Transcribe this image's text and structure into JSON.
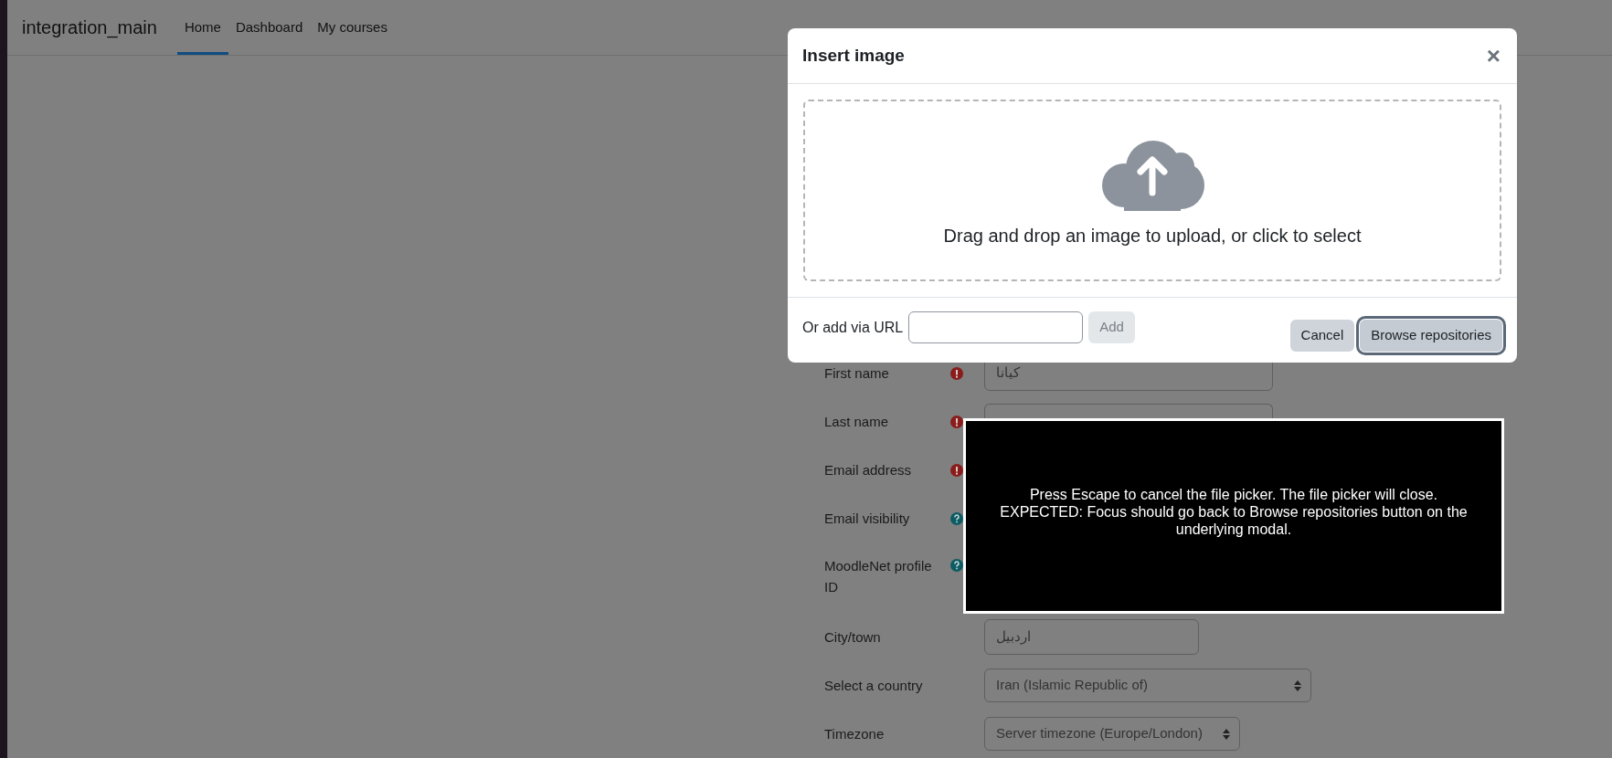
{
  "navbar": {
    "brand": "integration_main",
    "items": [
      {
        "label": "Home",
        "selected": true
      },
      {
        "label": "Dashboard",
        "selected": false
      },
      {
        "label": "My courses",
        "selected": false
      }
    ]
  },
  "form": {
    "fields": [
      {
        "label": "First name",
        "required": true,
        "help": false,
        "kind": "text",
        "value": "کیانا"
      },
      {
        "label": "Last name",
        "required": true,
        "help": false,
        "kind": "partial"
      },
      {
        "label": "Email address",
        "required": true,
        "help": false,
        "kind": "covered"
      },
      {
        "label": "Email visibility",
        "required": false,
        "help": true,
        "kind": "covered"
      },
      {
        "label": "MoodleNet profile ID",
        "required": false,
        "help": true,
        "kind": "covered"
      },
      {
        "label": "City/town",
        "required": false,
        "help": false,
        "kind": "text",
        "value": "اردبیل"
      },
      {
        "label": "Select a country",
        "required": false,
        "help": false,
        "kind": "select",
        "value": "Iran (Islamic Republic of)"
      },
      {
        "label": "Timezone",
        "required": false,
        "help": false,
        "kind": "select",
        "value": "Server timezone (Europe/London)"
      }
    ]
  },
  "modal": {
    "title": "Insert image",
    "close": "×",
    "dropzone_text": "Drag and drop an image to upload, or click to select",
    "url_label": "Or add via URL",
    "add_button": {
      "label": "Add",
      "disabled": true
    },
    "buttons": [
      {
        "label": "Cancel",
        "focused": false
      },
      {
        "label": "Browse repositories",
        "focused": true
      }
    ]
  },
  "instruction": "Press Escape to cancel the file picker. The file picker will close.\nEXPECTED: Focus should go back to Browse repositories button on the underlying modal."
}
